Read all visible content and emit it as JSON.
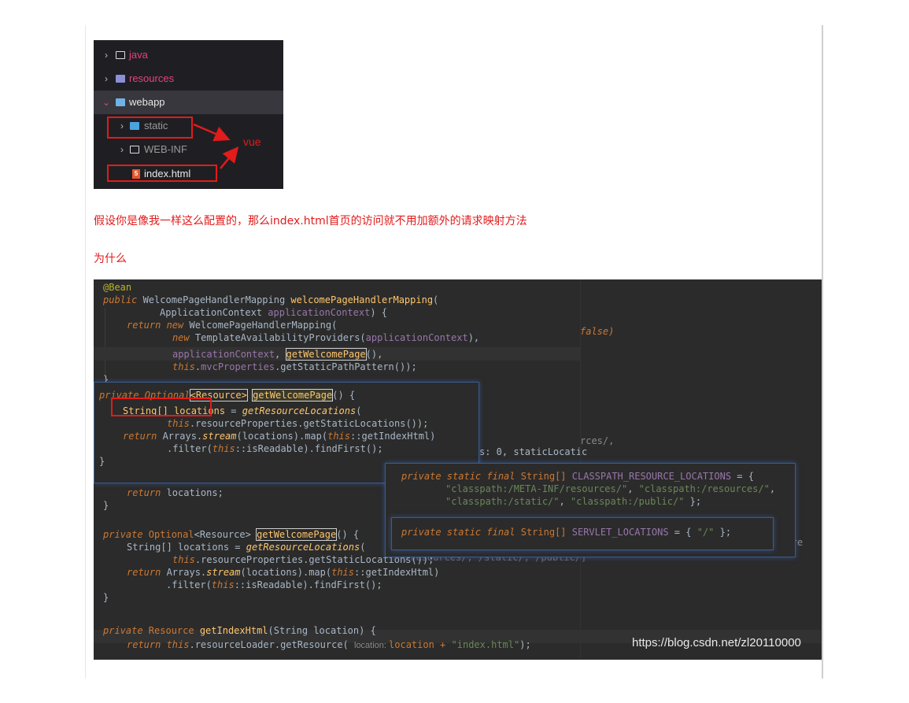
{
  "file_tree": {
    "items": [
      {
        "label": "java",
        "expanded": false,
        "icon": "folder-icon",
        "color": "#e8407a"
      },
      {
        "label": "resources",
        "expanded": false,
        "icon": "resources-folder-icon",
        "color": "#e8407a"
      },
      {
        "label": "webapp",
        "expanded": true,
        "icon": "webapp-folder-icon",
        "color": "#e6e6e6"
      },
      {
        "label": "static",
        "expanded": false,
        "icon": "static-folder-icon",
        "color": "#9a9a9a"
      },
      {
        "label": "WEB-INF",
        "expanded": false,
        "icon": "folder-icon",
        "color": "#9a9a9a"
      },
      {
        "label": "index.html",
        "icon": "html5-icon",
        "color": "#e8e8e8"
      }
    ],
    "annotation": "vue"
  },
  "captions": {
    "line1": "假设你是像我一样这么配置的，那么index.html首页的访问就不用加额外的请求映射方法",
    "line2": "为什么"
  },
  "code": {
    "watermark": "https://blog.csdn.net/zl20110000",
    "bg_fragments": {
      "false": "false)",
      "rces": "rces/,",
      "static": "s: 0, staticLocatic",
      "nf": "NF/re",
      "lower": "/resources/, /static/, /public/]"
    },
    "main": {
      "l1": "@Bean",
      "l2a": "public ",
      "l2b": "WelcomePageHandlerMapping ",
      "l2c": "welcomePageHandlerMapping",
      "l2d": "(",
      "l3a": "ApplicationContext ",
      "l3b": "applicationContext",
      "l3c": ") {",
      "l4a": "return new ",
      "l4b": "WelcomePageHandlerMapping(",
      "l5a": "new ",
      "l5b": "TemplateAvailabilityProviders(",
      "l5c": "applicationContext",
      "l5d": "),",
      "l6a": "applicationContext",
      "l6b": ", ",
      "l6c": "getWelcomePage",
      "l6d": "(),",
      "l7a": "this",
      "l7b": ".",
      "l7c": "mvcProperties",
      "l7d": ".getStaticPathPattern());",
      "l8": "}",
      "r1a": "return ",
      "r1b": "locations;",
      "r2": "}",
      "g1a": "private ",
      "g1b": "Optional",
      "g1c": "<Resource> ",
      "g1d": "getWelcomePage",
      "g1e": "() {",
      "g2a": "String[] locations = ",
      "g2b": "getResourceLocations",
      "g2c": "(",
      "g3a": "this",
      "g3b": ".resourceProperties.getStaticLocations());",
      "g4a": "return ",
      "g4b": "Arrays.",
      "g4c": "stream",
      "g4d": "(locations).map(",
      "g4e": "this",
      "g4f": "::getIndexHtml)",
      "g5a": ".filter(",
      "g5b": "this",
      "g5c": "::isReadable).findFirst();",
      "g6": "}",
      "h1a": "private ",
      "h1b": "Resource ",
      "h1c": "getIndexHtml",
      "h1d": "(String location) {",
      "h2a": "return ",
      "h2b": "this",
      "h2c": ".resourceLoader.getResource( ",
      "h2d": "location: ",
      "h2e": "location + ",
      "h2f": "\"index.html\"",
      "h2g": ");"
    },
    "popup1": {
      "p1a": "private ",
      "p1b": "Optional",
      "p1c": "<Resource>",
      "p1d": " ",
      "p1e": "getWelcomePage",
      "p1f": "() {",
      "p2a": "String[] locations",
      "p2b": " = ",
      "p2c": "getResourceLocations",
      "p2d": "(",
      "p3a": "this",
      "p3b": ".resourceProperties.getStaticLocations());",
      "p4a": "return ",
      "p4b": "Arrays.",
      "p4c": "stream",
      "p4d": "(locations).map(",
      "p4e": "this",
      "p4f": "::getIndexHtml)",
      "p5a": ".filter(",
      "p5b": "this",
      "p5c": "::isReadable).findFirst();",
      "p6": "}"
    },
    "popup2": {
      "a1": "private static final ",
      "a2": "String[] ",
      "a3": "CLASSPATH_RESOURCE_LOCATIONS",
      "a4": " = {",
      "b1": "\"classpath:/META-INF/resources/\"",
      "b2": ", ",
      "b3": "\"classpath:/resources/\"",
      "b4": ",",
      "c1": "\"classpath:/static/\"",
      "c2": ", ",
      "c3": "\"classpath:/public/\"",
      "c4": " };"
    },
    "popup3": {
      "a1": "private static final ",
      "a2": "String[] ",
      "a3": "SERVLET_LOCATIONS",
      "a4": " = { ",
      "a5": "\"/\"",
      "a6": " };"
    },
    "colors": {
      "keyword": "#cc7832",
      "function": "#ffc66d",
      "string": "#6a8759",
      "field": "#9876aa",
      "annotation": "#bbb529"
    }
  }
}
